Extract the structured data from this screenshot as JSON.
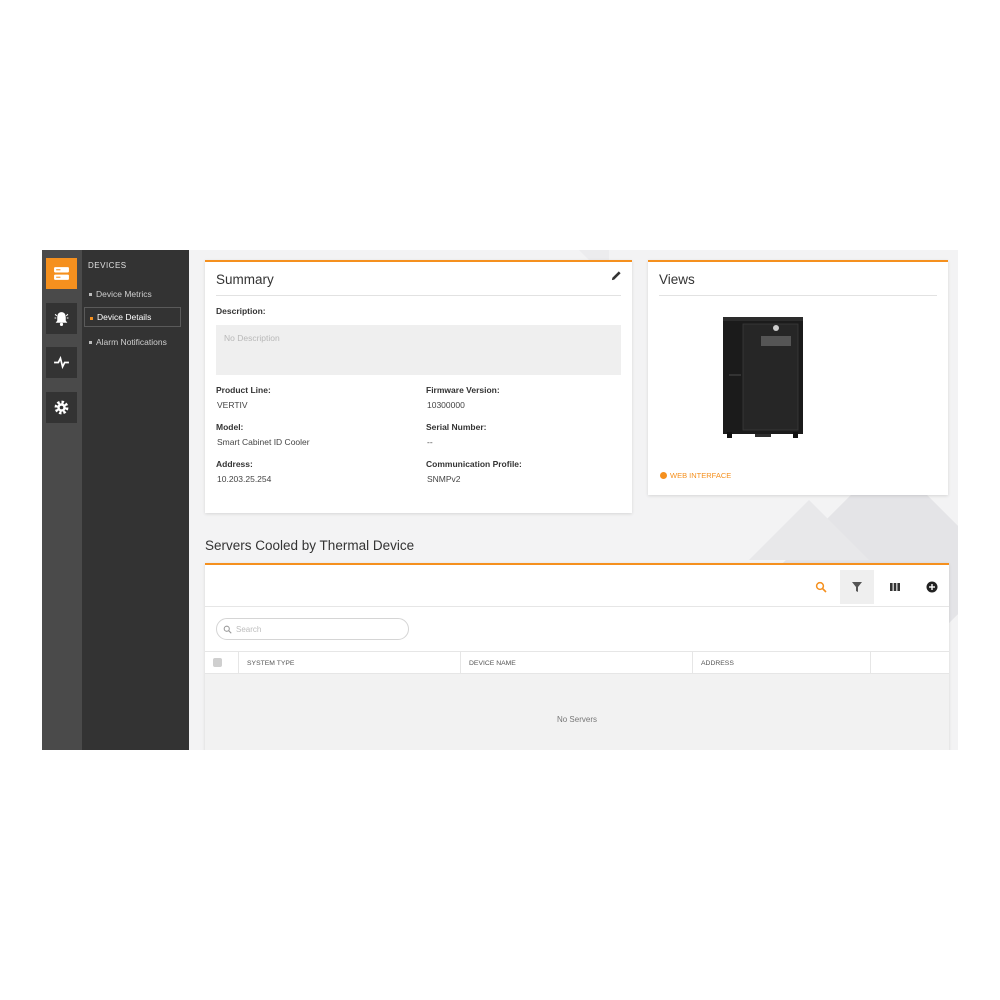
{
  "colors": {
    "accent": "#f5901e",
    "rail": "#4a4a4a",
    "nav": "#333333"
  },
  "rail": {
    "items": [
      {
        "icon": "devices-icon",
        "active": true
      },
      {
        "icon": "alarm-bell-icon",
        "active": false
      },
      {
        "icon": "pulse-icon",
        "active": false
      },
      {
        "icon": "gear-icon",
        "active": false
      }
    ]
  },
  "nav": {
    "header": "DEVICES",
    "items": [
      {
        "label": "Device Metrics"
      },
      {
        "label": "Device Details"
      },
      {
        "label": "Alarm Notifications"
      }
    ]
  },
  "summary": {
    "title": "Summary",
    "description_label": "Description:",
    "description_placeholder": "No Description",
    "product_line_label": "Product Line:",
    "product_line": "VERTIV",
    "firmware_label": "Firmware Version:",
    "firmware": "10300000",
    "model_label": "Model:",
    "model": "Smart Cabinet ID Cooler",
    "serial_label": "Serial Number:",
    "serial": "--",
    "address_label": "Address:",
    "address": "10.203.25.254",
    "comm_label": "Communication Profile:",
    "comm": "SNMPv2"
  },
  "views": {
    "title": "Views",
    "web_interface": "WEB INTERFACE"
  },
  "servers": {
    "title": "Servers Cooled by Thermal Device",
    "search_placeholder": "Search",
    "columns": [
      "SYSTEM TYPE",
      "DEVICE NAME",
      "ADDRESS"
    ],
    "empty_text": "No Servers"
  }
}
